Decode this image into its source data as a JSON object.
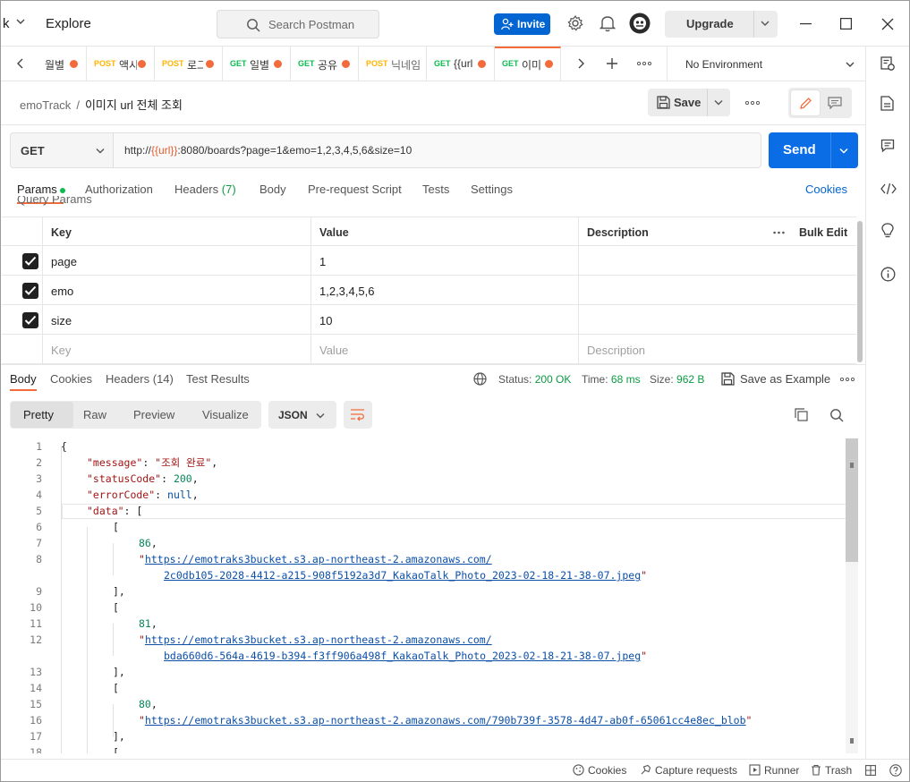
{
  "titlebar": {
    "workspace_fragment": "k",
    "explore_label": "Explore",
    "search_placeholder": "Search Postman",
    "invite_label": "Invite",
    "upgrade_label": "Upgrade"
  },
  "tabs": [
    {
      "method": "",
      "name": "월별",
      "dirty": true
    },
    {
      "method": "POST",
      "name": "액시",
      "dirty": true
    },
    {
      "method": "POST",
      "name": "로그",
      "dirty": true
    },
    {
      "method": "GET",
      "name": "일별",
      "dirty": true
    },
    {
      "method": "GET",
      "name": "공유",
      "dirty": true
    },
    {
      "method": "POST",
      "name": "닉네임",
      "dirty": false
    },
    {
      "method": "GET",
      "name": "{{url",
      "dirty": true
    },
    {
      "method": "GET",
      "name": "이미",
      "dirty": true
    }
  ],
  "environment": "No Environment",
  "request": {
    "breadcrumb_parent": "emoTrack",
    "breadcrumb_sep": "/",
    "name": "이미지 url 전체 조회",
    "save_label": "Save",
    "method": "GET",
    "url_prefix": "http://",
    "url_var": "{{url}}",
    "url_rest": ":8080/boards?page=1&emo=1,2,3,4,5,6&size=10",
    "send_label": "Send"
  },
  "request_tabs": [
    {
      "label": "Params",
      "count": ""
    },
    {
      "label": "Authorization",
      "count": ""
    },
    {
      "label": "Headers",
      "count": "(7)"
    },
    {
      "label": "Body",
      "count": ""
    },
    {
      "label": "Pre-request Script",
      "count": ""
    },
    {
      "label": "Tests",
      "count": ""
    },
    {
      "label": "Settings",
      "count": ""
    }
  ],
  "cookies_link": "Cookies",
  "query_params_title": "Query Params",
  "params_table": {
    "headers": {
      "key": "Key",
      "value": "Value",
      "description": "Description"
    },
    "bulk_edit": "Bulk Edit",
    "rows": [
      {
        "key": "page",
        "value": "1",
        "checked": true
      },
      {
        "key": "emo",
        "value": "1,2,3,4,5,6",
        "checked": true
      },
      {
        "key": "size",
        "value": "10",
        "checked": true
      }
    ],
    "placeholder": {
      "key": "Key",
      "value": "Value",
      "description": "Description"
    }
  },
  "response_tabs": [
    {
      "label": "Body"
    },
    {
      "label": "Cookies"
    },
    {
      "label": "Headers (14)"
    },
    {
      "label": "Test Results"
    }
  ],
  "response_status": {
    "status_label": "Status:",
    "status_value": "200 OK",
    "time_label": "Time:",
    "time_value": "68 ms",
    "size_label": "Size:",
    "size_value": "962 B",
    "save_example": "Save as Example"
  },
  "view_modes": [
    "Pretty",
    "Raw",
    "Preview",
    "Visualize"
  ],
  "format": "JSON",
  "response_body": {
    "message_key": "\"message\"",
    "message_val": "\"조회 완료\"",
    "statusCode_key": "\"statusCode\"",
    "statusCode_val": "200",
    "errorCode_key": "\"errorCode\"",
    "errorCode_val": "null",
    "data_key": "\"data\"",
    "item1_id": "86",
    "item1_url_a": "https://emotraks3bucket.s3.ap-northeast-2.amazonaws.com/",
    "item1_url_b": "2c0db105-2028-4412-a215-908f5192a3d7_KakaoTalk_Photo_2023-02-18-21-38-07.jpeg",
    "item2_id": "81",
    "item2_url_a": "https://emotraks3bucket.s3.ap-northeast-2.amazonaws.com/",
    "item2_url_b": "bda660d6-564a-4619-b394-f3ff906a498f_KakaoTalk_Photo_2023-02-18-21-38-07.jpeg",
    "item3_id": "80",
    "item3_url": "https://emotraks3bucket.s3.ap-northeast-2.amazonaws.com/790b739f-3578-4d47-ab0f-65061cc4e8ec_blob"
  },
  "line_numbers": [
    "1",
    "2",
    "3",
    "4",
    "5",
    "6",
    "7",
    "8",
    "9",
    "10",
    "11",
    "12",
    "13",
    "14",
    "15",
    "16",
    "17",
    "18"
  ],
  "footer": {
    "cookies": "Cookies",
    "capture": "Capture requests",
    "runner": "Runner",
    "trash": "Trash"
  }
}
